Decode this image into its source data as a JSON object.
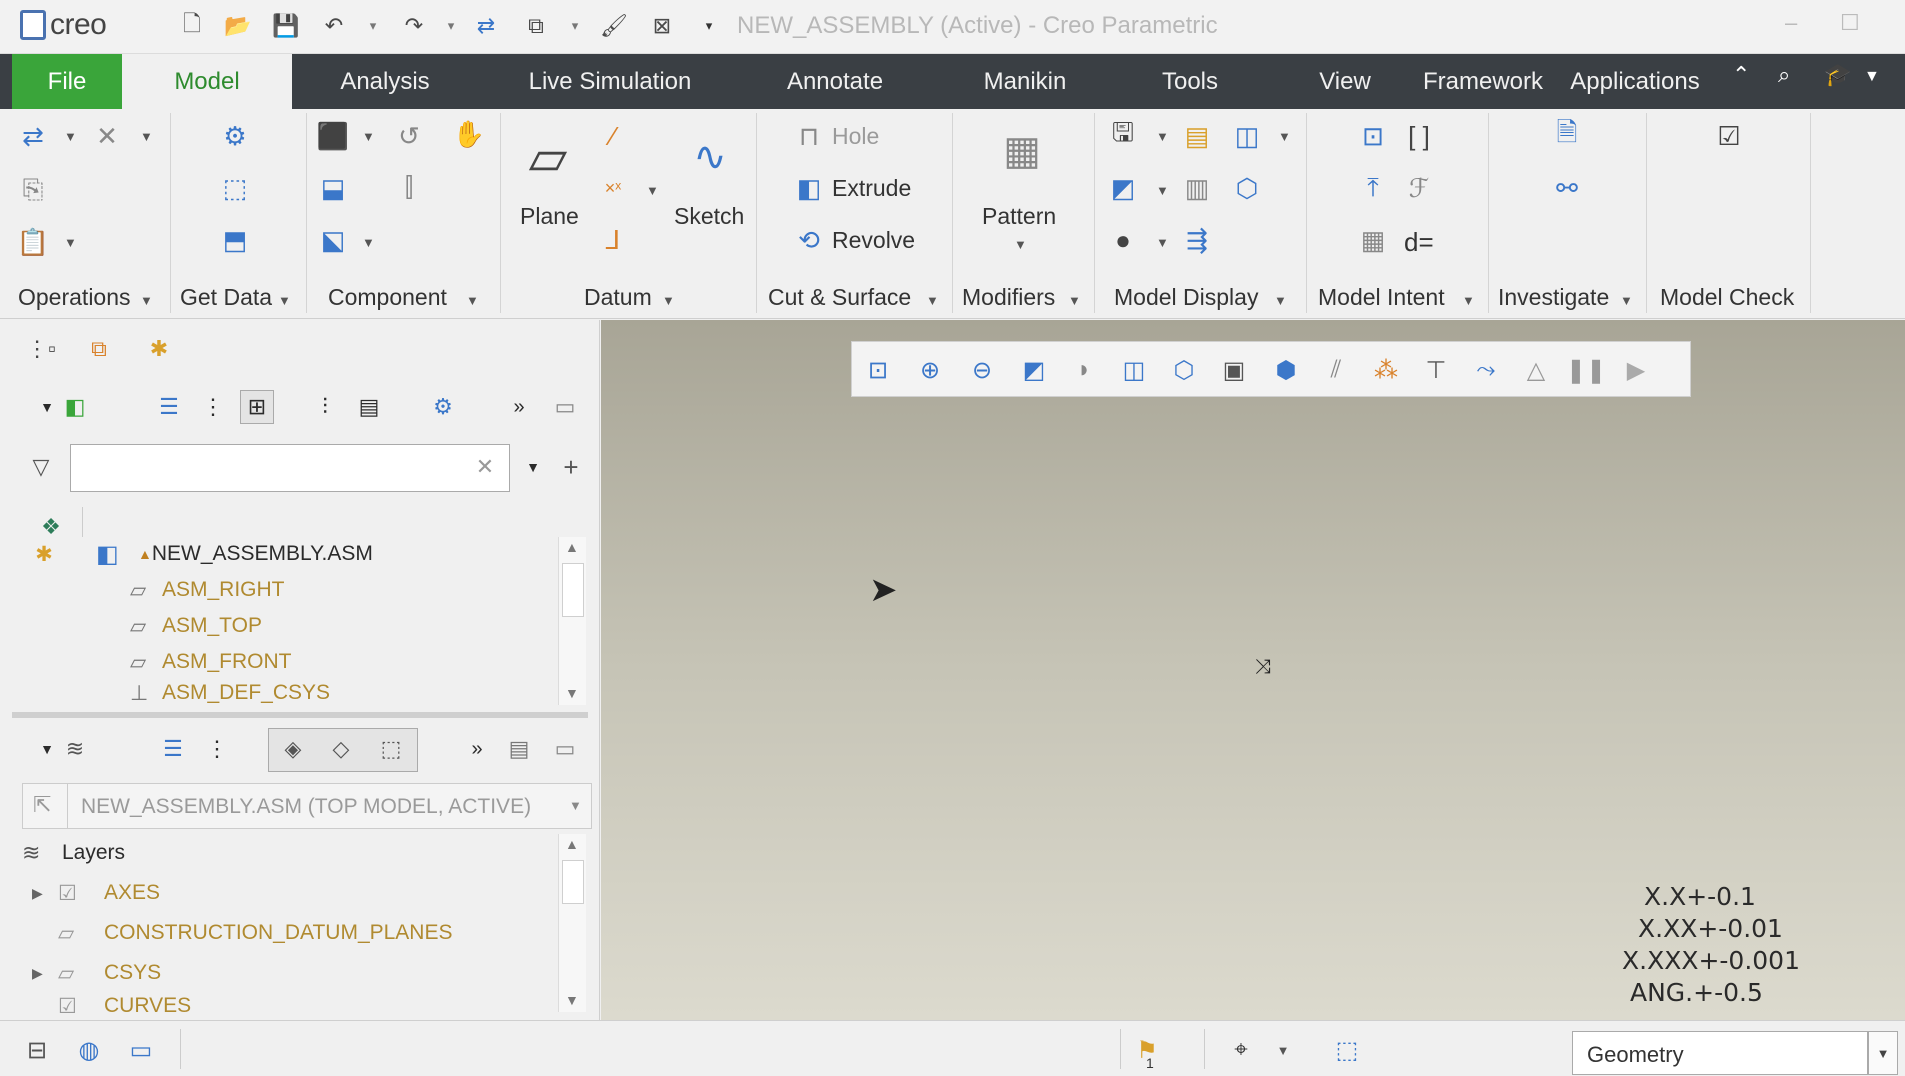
{
  "app": {
    "logo_text": "creo",
    "window_title": "NEW_ASSEMBLY (Active) - Creo Parametric"
  },
  "tabs": [
    {
      "label": "File"
    },
    {
      "label": "Model"
    },
    {
      "label": "Analysis"
    },
    {
      "label": "Live Simulation"
    },
    {
      "label": "Annotate"
    },
    {
      "label": "Manikin"
    },
    {
      "label": "Tools"
    },
    {
      "label": "View"
    },
    {
      "label": "Framework"
    },
    {
      "label": "Applications"
    }
  ],
  "ribbon": {
    "groups": {
      "operations": "Operations",
      "get_data": "Get Data",
      "component": "Component",
      "datum": "Datum",
      "cut_surface": "Cut & Surface",
      "modifiers": "Modifiers",
      "model_display": "Model Display",
      "model_intent": "Model Intent",
      "investigate": "Investigate",
      "model_check": "Model Check"
    },
    "buttons": {
      "plane": "Plane",
      "sketch": "Sketch",
      "hole": "Hole",
      "extrude": "Extrude",
      "revolve": "Revolve",
      "pattern": "Pattern",
      "d_equals": "d="
    }
  },
  "model_tree": {
    "filter_placeholder": "",
    "items": [
      {
        "label": "NEW_ASSEMBLY.ASM"
      },
      {
        "label": "ASM_RIGHT"
      },
      {
        "label": "ASM_TOP"
      },
      {
        "label": "ASM_FRONT"
      },
      {
        "label": "ASM_DEF_CSYS"
      }
    ]
  },
  "layer_tree": {
    "active_model": "NEW_ASSEMBLY.ASM (TOP MODEL, ACTIVE)",
    "root_label": "Layers",
    "items": [
      {
        "label": "AXES"
      },
      {
        "label": "CONSTRUCTION_DATUM_PLANES"
      },
      {
        "label": "CSYS"
      },
      {
        "label": "CURVES"
      }
    ]
  },
  "viewport": {
    "tolerances": [
      "X.X+-0.1",
      "X.XX+-0.01",
      "X.XXX+-0.001",
      "ANG.+-0.5"
    ]
  },
  "statusbar": {
    "flag_count": "1",
    "selection_filter": "Geometry"
  },
  "colors": {
    "file_tab": "#3aa53a",
    "active_tab_text": "#2e8b2e",
    "tab_bar": "#3a3f44",
    "accent_blue": "#3b77c9"
  }
}
